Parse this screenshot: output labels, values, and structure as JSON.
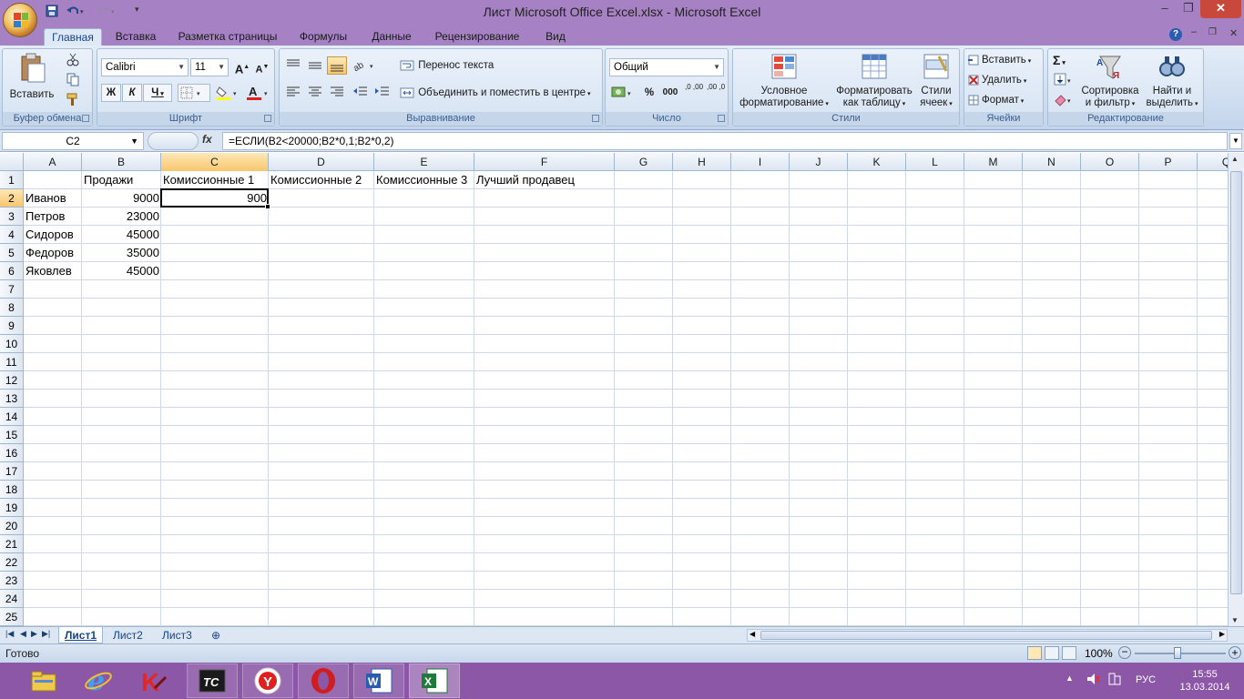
{
  "window": {
    "title": "Лист Microsoft Office Excel.xlsx - Microsoft Excel",
    "controls": {
      "minimize": "–",
      "maximize": "❐",
      "close": "✕"
    }
  },
  "ribbon": {
    "tabs": [
      "Главная",
      "Вставка",
      "Разметка страницы",
      "Формулы",
      "Данные",
      "Рецензирование",
      "Вид"
    ],
    "active_tab": "Главная",
    "groups": {
      "clipboard": {
        "label": "Буфер обмена",
        "paste": "Вставить"
      },
      "font": {
        "label": "Шрифт",
        "font_name": "Calibri",
        "font_size": "11",
        "bold": "Ж",
        "italic": "К",
        "underline": "Ч"
      },
      "alignment": {
        "label": "Выравнивание",
        "wrap": "Перенос текста",
        "merge": "Объединить и поместить в центре"
      },
      "number": {
        "label": "Число",
        "format": "Общий",
        "percent": "%",
        "thousands": "000",
        "inc_dec": ",0 ,00",
        "dec_dec": ",00 ,0"
      },
      "styles": {
        "label": "Стили",
        "conditional_1": "Условное",
        "conditional_2": "форматирование",
        "format_table_1": "Форматировать",
        "format_table_2": "как таблицу",
        "cell_styles_1": "Стили",
        "cell_styles_2": "ячеек"
      },
      "cells": {
        "label": "Ячейки",
        "insert": "Вставить",
        "delete": "Удалить",
        "format": "Формат"
      },
      "editing": {
        "label": "Редактирование",
        "sort_1": "Сортировка",
        "sort_2": "и фильтр",
        "find_1": "Найти и",
        "find_2": "выделить"
      }
    }
  },
  "formula_bar": {
    "name_box": "C2",
    "fx": "fx",
    "formula": "=ЕСЛИ(B2<20000;B2*0,1;B2*0,2)"
  },
  "sheet": {
    "columns": [
      "A",
      "B",
      "C",
      "D",
      "E",
      "F",
      "G",
      "H",
      "I",
      "J",
      "K",
      "L",
      "M",
      "N",
      "O",
      "P",
      "Q"
    ],
    "rows": [
      "1",
      "2",
      "3",
      "4",
      "5",
      "6",
      "7",
      "8",
      "9",
      "10",
      "11",
      "12",
      "13",
      "14",
      "15",
      "16",
      "17",
      "18",
      "19",
      "20",
      "21",
      "22",
      "23",
      "24",
      "25"
    ],
    "selected_cell": "C2",
    "header_row": {
      "B": "Продажи",
      "C": "Комиссионные 1",
      "D": "Комиссионные 2",
      "E": "Комиссионные 3",
      "F": "Лучший продавец"
    },
    "data": [
      {
        "name": "Иванов",
        "sales": "9000",
        "comm1": "900"
      },
      {
        "name": "Петров",
        "sales": "23000",
        "comm1": ""
      },
      {
        "name": "Сидоров",
        "sales": "45000",
        "comm1": ""
      },
      {
        "name": "Федоров",
        "sales": "35000",
        "comm1": ""
      },
      {
        "name": "Яковлев",
        "sales": "45000",
        "comm1": ""
      }
    ]
  },
  "sheet_tabs": [
    "Лист1",
    "Лист2",
    "Лист3"
  ],
  "active_sheet": "Лист1",
  "status": {
    "text": "Готово",
    "zoom": "100%"
  },
  "taskbar": {
    "apps": [
      "file-explorer",
      "internet-explorer",
      "kaspersky",
      "total-commander",
      "yandex-browser",
      "opera",
      "word",
      "excel"
    ],
    "lang": "РУС",
    "time": "15:55",
    "date": "13.03.2014"
  },
  "colors": {
    "title_bar": "#a682c4",
    "taskbar": "#8b57a6",
    "selected_header": "#f8c66e",
    "ribbon_text": "#15428b"
  }
}
